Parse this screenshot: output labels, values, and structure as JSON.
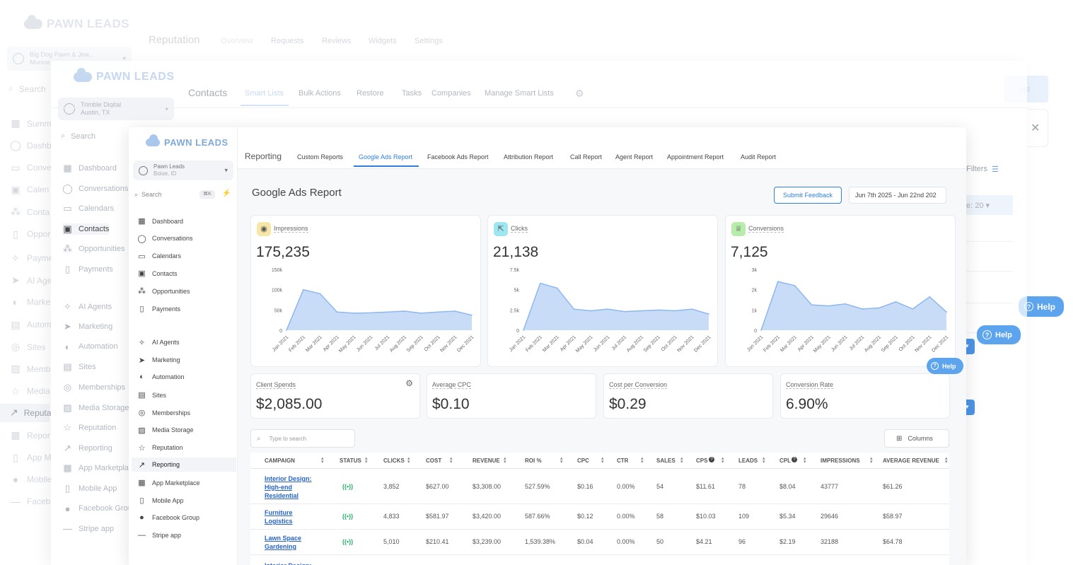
{
  "back": {
    "logo": "PAWN LEADS",
    "account_name": "Big Dog Pawn & Jew...",
    "account_sub": "Muncie",
    "title": "Reputation",
    "tabs": [
      "Overview",
      "Requests",
      "Reviews",
      "Widgets",
      "Settings"
    ],
    "search": "Search",
    "nav": [
      "Summ",
      "Dashb",
      "Conve",
      "Calen",
      "Conta",
      "Oppor",
      "Payme",
      "AI Age",
      "Marke",
      "Autom",
      "Sites",
      "Memb",
      "Media",
      "Reputa",
      "Repor",
      "App M",
      "Mobile",
      "Faceb"
    ],
    "right_button": "est",
    "help": "Help"
  },
  "mid": {
    "logo": "PAWN LEADS",
    "account_name": "Trimble Digital",
    "account_sub": "Austin, TX",
    "title": "Contacts",
    "tabs": [
      "Smart Lists",
      "Bulk Actions",
      "Restore",
      "Tasks",
      "Companies",
      "Manage Smart Lists"
    ],
    "search": "Search",
    "nav": [
      "Dashboard",
      "Conversations",
      "Calendars",
      "Contacts",
      "Opportunities",
      "Payments",
      "AI Agents",
      "Marketing",
      "Automation",
      "Sites",
      "Memberships",
      "Media Storage",
      "Reputation",
      "Reporting",
      "App Marketpla",
      "Mobile App",
      "Facebook Grou",
      "Stripe app"
    ],
    "filters": "Filters",
    "page_size": "e: 20",
    "help": "Help",
    "badge_a": "2",
    "badge_b": "4"
  },
  "front": {
    "logo": "PAWN LEADS",
    "account_name": "Pawn Leads",
    "account_sub": "Boise, ID",
    "search_placeholder": "Search",
    "search_shortcut": "⌘K",
    "nav": [
      "Dashboard",
      "Conversations",
      "Calendars",
      "Contacts",
      "Opportunities",
      "Payments",
      "AI Agents",
      "Marketing",
      "Automation",
      "Sites",
      "Memberships",
      "Media Storage",
      "Reputation",
      "Reporting",
      "App Marketplace",
      "Mobile App",
      "Facebook Group",
      "Stripe app"
    ],
    "header_title": "Reporting",
    "tabs": [
      "Custom Reports",
      "Google Ads Report",
      "Facebook Ads Report",
      "Attribution Report",
      "Call Report",
      "Agent Report",
      "Appointment Report",
      "Audit Report"
    ],
    "page_title": "Google Ads Report",
    "feedback_button": "Submit Feedback",
    "date_range": "Jun 7th 2025 - Jun 22nd 202",
    "help": "Help",
    "metrics": [
      {
        "label": "Impressions",
        "value": "175,235",
        "color": "#f6e7a8",
        "icon": "eye-icon"
      },
      {
        "label": "Clicks",
        "value": "21,138",
        "color": "#9ee6f0",
        "icon": "cursor-icon"
      },
      {
        "label": "Conversions",
        "value": "7,125",
        "color": "#b8ecaa",
        "icon": "trophy-icon"
      }
    ],
    "stats": [
      {
        "label": "Client Spends",
        "value": "$2,085.00"
      },
      {
        "label": "Average CPC",
        "value": "$0.10"
      },
      {
        "label": "Cost per Conversion",
        "value": "$0.29"
      },
      {
        "label": "Conversion Rate",
        "value": "6.90%"
      }
    ],
    "table_search": "Type to search",
    "columns_button": "Columns",
    "table": {
      "headers": [
        "CAMPAIGN",
        "STATUS",
        "CLICKS",
        "COST",
        "REVENUE",
        "ROI %",
        "CPC",
        "CTR",
        "SALES",
        "CPS",
        "LEADS",
        "CPL",
        "IMPRESSIONS",
        "AVERAGE REVENUE"
      ],
      "rows": [
        {
          "campaign": [
            "Interior Design:",
            "High-end",
            "Residential"
          ],
          "status": "((•))",
          "clicks": "3,852",
          "cost": "$627.00",
          "revenue": "$3,308.00",
          "roi": "527.59%",
          "cpc": "$0.16",
          "ctr": "0.00%",
          "sales": "54",
          "cps": "$11.61",
          "leads": "78",
          "cpl": "$8.04",
          "impressions": "43777",
          "avg_revenue": "$61.26"
        },
        {
          "campaign": [
            "Furniture",
            "Logistics"
          ],
          "status": "((•))",
          "clicks": "4,833",
          "cost": "$581.97",
          "revenue": "$3,420.00",
          "roi": "587.66%",
          "cpc": "$0.12",
          "ctr": "0.00%",
          "sales": "58",
          "cps": "$10.03",
          "leads": "109",
          "cpl": "$5.34",
          "impressions": "29646",
          "avg_revenue": "$58.97"
        },
        {
          "campaign": [
            "Lawn Space",
            "Gardening"
          ],
          "status": "((•))",
          "clicks": "5,010",
          "cost": "$210.41",
          "revenue": "$3,239.00",
          "roi": "1,539.38%",
          "cpc": "$0.04",
          "ctr": "0.00%",
          "sales": "50",
          "cps": "$4.21",
          "leads": "96",
          "cpl": "$2.19",
          "impressions": "32188",
          "avg_revenue": "$64.78"
        },
        {
          "campaign": [
            "Interior Design:"
          ],
          "status": "",
          "clicks": "",
          "cost": "",
          "revenue": "",
          "roi": "",
          "cpc": "",
          "ctr": "",
          "sales": "",
          "cps": "",
          "leads": "",
          "cpl": "",
          "impressions": "",
          "avg_revenue": ""
        }
      ]
    }
  },
  "chart_data": [
    {
      "type": "area",
      "categories": [
        "Jan 2021",
        "Feb 2021",
        "Mar 2021",
        "Apr 2021",
        "May 2021",
        "Jun 2021",
        "Jul 2021",
        "Aug 2021",
        "Sep 2021",
        "Oct 2021",
        "Nov 2021",
        "Dec 2021"
      ],
      "values": [
        0,
        100000,
        90000,
        45000,
        42000,
        43000,
        45000,
        47000,
        42000,
        45000,
        47000,
        37000
      ],
      "yticks": [
        "0",
        "50k",
        "100k",
        "150k"
      ],
      "ylim": [
        0,
        150000
      ]
    },
    {
      "type": "area",
      "categories": [
        "Jan 2021",
        "Feb 2021",
        "Mar 2021",
        "Apr 2021",
        "May 2021",
        "Jun 2021",
        "Jul 2021",
        "Aug 2021",
        "Sep 2021",
        "Oct 2021",
        "Nov 2021",
        "Dec 2021"
      ],
      "values": [
        0,
        5800,
        5200,
        2600,
        2400,
        2600,
        2300,
        2400,
        2500,
        2400,
        2600,
        2000
      ],
      "yticks": [
        "0",
        "2.5k",
        "5k",
        "7.5k"
      ],
      "ylim": [
        0,
        7500
      ]
    },
    {
      "type": "area",
      "categories": [
        "Jan 2021",
        "Feb 2021",
        "Mar 2021",
        "Apr 2021",
        "May 2021",
        "Jun 2021",
        "Jul 2021",
        "Aug 2021",
        "Sep 2021",
        "Oct 2021",
        "Nov 2021",
        "Dec 2021"
      ],
      "values": [
        0,
        2400,
        2200,
        1250,
        1200,
        1300,
        1050,
        1100,
        1400,
        1050,
        1650,
        900
      ],
      "yticks": [
        "0",
        "1k",
        "2k",
        "3k"
      ],
      "ylim": [
        0,
        3000
      ]
    }
  ]
}
